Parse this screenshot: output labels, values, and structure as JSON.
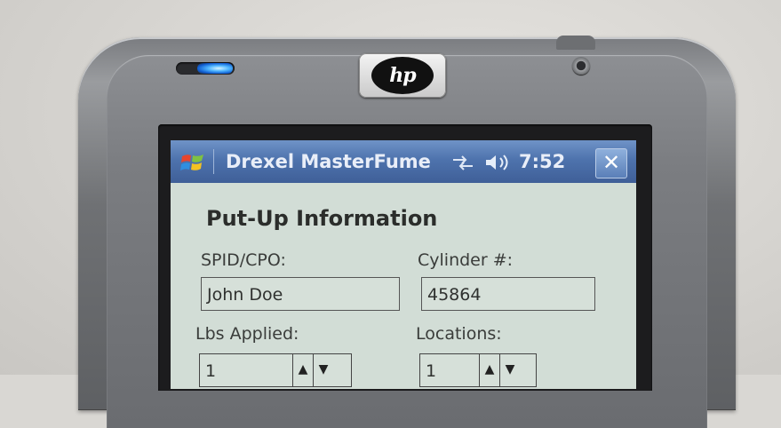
{
  "device": {
    "brand_logo": "hp",
    "led_color": "#3aa8ff"
  },
  "taskbar": {
    "title": "Drexel MasterFume",
    "time": "7:52",
    "close_label": "✕",
    "start_icon": "windows-flag-icon",
    "connectivity_icon": "sync-arrows-icon",
    "volume_icon": "speaker-icon"
  },
  "form": {
    "heading": "Put-Up Information",
    "spid_label": "SPID/CPO:",
    "spid_value": "John Doe",
    "cylinder_label": "Cylinder #:",
    "cylinder_value": "45864",
    "lbs_label": "Lbs Applied:",
    "lbs_value": "1",
    "locations_label": "Locations:",
    "locations_value": "1",
    "spin_up": "▲",
    "spin_down": "▼"
  }
}
